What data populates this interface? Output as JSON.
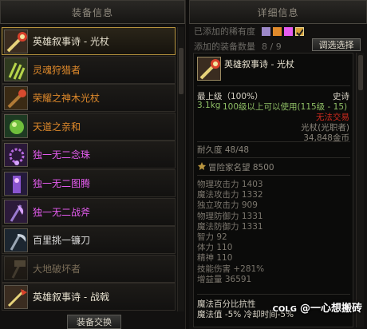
{
  "left_panel": {
    "title": "装备信息",
    "exchange_button": "装备交换",
    "items": [
      {
        "name": "英雄叙事诗 - 光杖",
        "color": "#e8e2d0",
        "selected": true,
        "dim": false,
        "icon": "scepter-icon"
      },
      {
        "name": "灵魂狩猎者",
        "color": "#e08a2b",
        "selected": false,
        "dim": false,
        "icon": "claw-icon"
      },
      {
        "name": "荣耀之神木光杖",
        "color": "#e08a2b",
        "selected": false,
        "dim": false,
        "icon": "wood-scepter-icon"
      },
      {
        "name": "天道之亲和",
        "color": "#e08a2b",
        "selected": false,
        "dim": false,
        "icon": "orb-icon"
      },
      {
        "name": "独一无二念珠",
        "color": "#e55cf0",
        "selected": false,
        "dim": false,
        "icon": "rosary-icon"
      },
      {
        "name": "独一无二图腾",
        "color": "#e55cf0",
        "selected": false,
        "dim": false,
        "icon": "totem-icon"
      },
      {
        "name": "独一无二战斧",
        "color": "#e55cf0",
        "selected": false,
        "dim": false,
        "icon": "battle-axe-icon"
      },
      {
        "name": "百里挑一镰刀",
        "color": "#dddddd",
        "selected": false,
        "dim": false,
        "icon": "scythe-icon"
      },
      {
        "name": "大地破坏者",
        "color": "#7a6d58",
        "selected": false,
        "dim": true,
        "icon": "hammer-icon"
      },
      {
        "name": "英雄叙事诗 - 战戟",
        "color": "#e8e2d0",
        "selected": false,
        "dim": false,
        "icon": "halberd-icon"
      }
    ]
  },
  "right_panel": {
    "title": "详细信息",
    "rarity_label": "已添加的稀有度",
    "rarity_colors": [
      "#9c88c8",
      "#e08a2b",
      "#e55cf0",
      "#d9a23a"
    ],
    "count_label": "添加的装备数量",
    "count_value": "8 / 9",
    "filter_button": "调选选择",
    "item": {
      "name": "英雄叙事诗 - 光杖",
      "level": "最上级（100%）",
      "rarity": "史诗",
      "weight": "3.1kg",
      "requirement": "100级以上可以使用(115级 - 15)",
      "trade": "无法交易",
      "type": "光杖(光职者)",
      "price": "34,848金币",
      "durability": "耐久度 48/48",
      "fame": "冒险家名望 8500",
      "stats": [
        "物理攻击力 1403",
        "魔法攻击力 1332",
        "独立攻击力 909",
        "物理防御力 1331",
        "魔法防御力 1331",
        "智力 92",
        "体力 110",
        "精神 110",
        "技能伤害 +281%",
        "增益量 36591"
      ],
      "bottom": [
        "魔法百分比抗性",
        "魔法值 -5% 冷却时间-5%"
      ]
    }
  },
  "watermark": "@一心想搬砖",
  "watermark_logo": "COLG"
}
